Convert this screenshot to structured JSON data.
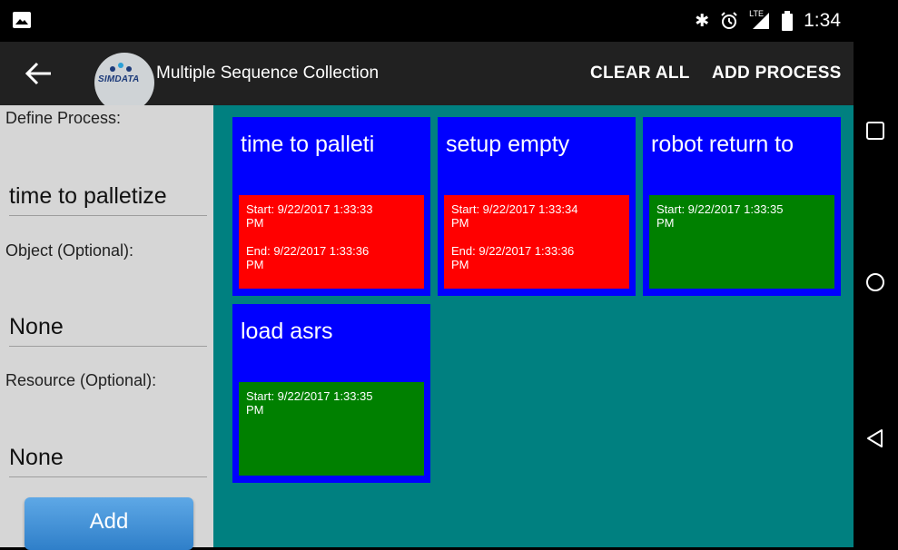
{
  "status_bar": {
    "time": "1:34",
    "left_icon": "image-icon",
    "right_icons": [
      "bluetooth-icon",
      "alarm-icon",
      "lte-signal-icon",
      "battery-icon"
    ],
    "lte_label": "LTE"
  },
  "app_bar": {
    "title": "Multiple Sequence Collection",
    "logo_text": "SIMDATA",
    "clear_all_label": "CLEAR ALL",
    "add_process_label": "ADD PROCESS"
  },
  "left_panel": {
    "define_process_label": "Define Process:",
    "define_process_value": "time to palletize",
    "object_label": "Object (Optional):",
    "object_value": "None",
    "resource_label": "Resource (Optional):",
    "resource_value": "None",
    "add_button_label": "Add"
  },
  "processes": [
    {
      "title": "time to palleti",
      "state": "finished",
      "start": "Start: 9/22/2017 1:33:33",
      "start_suffix": "PM",
      "end": "End:  9/22/2017 1:33:36",
      "end_suffix": "PM"
    },
    {
      "title": "setup empty",
      "state": "finished",
      "start": "Start: 9/22/2017 1:33:34",
      "start_suffix": "PM",
      "end": "End:  9/22/2017 1:33:36",
      "end_suffix": "PM"
    },
    {
      "title": "robot return to",
      "state": "running",
      "start": "Start: 9/22/2017 1:33:35",
      "start_suffix": "PM"
    },
    {
      "title": "load asrs",
      "state": "running",
      "start": "Start: 9/22/2017 1:33:35",
      "start_suffix": "PM"
    }
  ],
  "colors": {
    "grid_bg": "#008080",
    "card_bg": "#0000ff",
    "finished": "#ff0000",
    "running": "#008000"
  },
  "nav_bar": {
    "icons": [
      "recents-square-icon",
      "home-circle-icon",
      "back-triangle-icon"
    ]
  }
}
